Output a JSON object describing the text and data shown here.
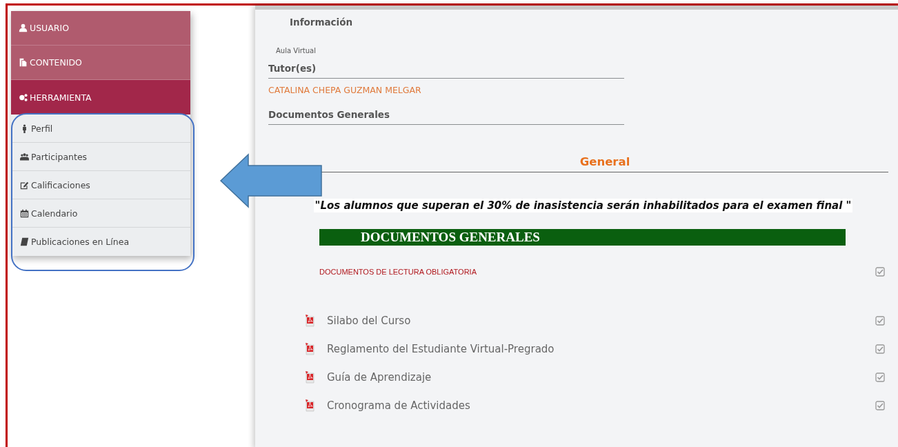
{
  "sidebar": {
    "items": [
      {
        "label": "USUARIO",
        "selected": false
      },
      {
        "label": "CONTENIDO",
        "selected": false
      },
      {
        "label": "HERRAMIENTA",
        "selected": true
      }
    ],
    "submenu": [
      {
        "label": "Perfil"
      },
      {
        "label": "Participantes"
      },
      {
        "label": "Calificaciones"
      },
      {
        "label": "Calendario"
      },
      {
        "label": "Publicaciones en Línea"
      }
    ]
  },
  "main": {
    "heading": "Información",
    "subtitle": "Aula Virtual",
    "tutors_label": "Tutor(es)",
    "tutor": "CATALINA CHEPA GUZMAN MELGAR",
    "documents_label": "Documentos Generales",
    "section_title": "General",
    "notice": "\"Los alumnos que superan el 30% de inasistencia serán inhabilitados para el examen final \"",
    "banner": "DOCUMENTOS GENERALES",
    "group": {
      "title": "DOCUMENTOS DE LECTURA OBLIGATORIA",
      "checked": true
    },
    "documents": [
      {
        "title": "Silabo del Curso",
        "checked": true
      },
      {
        "title": "Reglamento del Estudiante Virtual-Pregrado",
        "checked": true
      },
      {
        "title": "Guía de Aprendizaje",
        "checked": true
      },
      {
        "title": "Cronograma de Actividades",
        "checked": true
      }
    ]
  }
}
